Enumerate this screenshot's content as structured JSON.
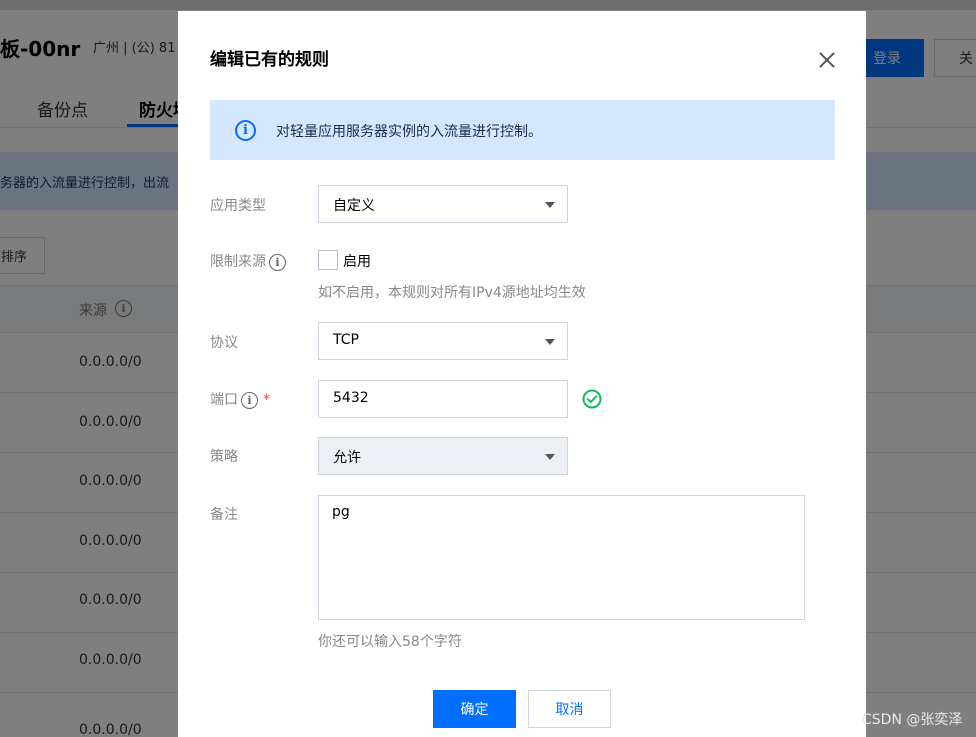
{
  "background": {
    "page_title": "板-00nr",
    "region": "广州 | (公) 81",
    "login_button": "登录",
    "close_button": "关",
    "tabs": [
      "备份点",
      "防火墙"
    ],
    "info_text": "务器的入流量进行控制，出流",
    "sort_button": "排序",
    "table_header_source": "来源",
    "rows": [
      "0.0.0.0/0",
      "0.0.0.0/0",
      "0.0.0.0/0",
      "0.0.0.0/0",
      "0.0.0.0/0",
      "0.0.0.0/0",
      "0.0.0.0/0"
    ]
  },
  "modal": {
    "title": "编辑已有的规则",
    "alert_text": "对轻量应用服务器实例的入流量进行控制。",
    "fields": {
      "app_type": {
        "label": "应用类型",
        "value": "自定义"
      },
      "source_limit": {
        "label": "限制来源",
        "checkbox_label": "启用",
        "checked": false,
        "hint": "如不启用，本规则对所有IPv4源地址均生效"
      },
      "protocol": {
        "label": "协议",
        "value": "TCP"
      },
      "port": {
        "label": "端口",
        "value": "5432",
        "required": "*"
      },
      "policy": {
        "label": "策略",
        "value": "允许"
      },
      "remark": {
        "label": "备注",
        "value": "pg",
        "hint": "你还可以输入58个字符"
      }
    },
    "buttons": {
      "confirm": "确定",
      "cancel": "取消"
    }
  },
  "watermark": "CSDN @张奕泽",
  "colors": {
    "primary": "#006eff",
    "alert_bg": "#d5e7ff",
    "success": "#0abf5b",
    "required": "#e54545"
  },
  "icons": {
    "close": "close-icon",
    "info": "info-icon",
    "help": "help-icon",
    "caret": "chevron-down-icon",
    "success": "check-circle-icon"
  }
}
